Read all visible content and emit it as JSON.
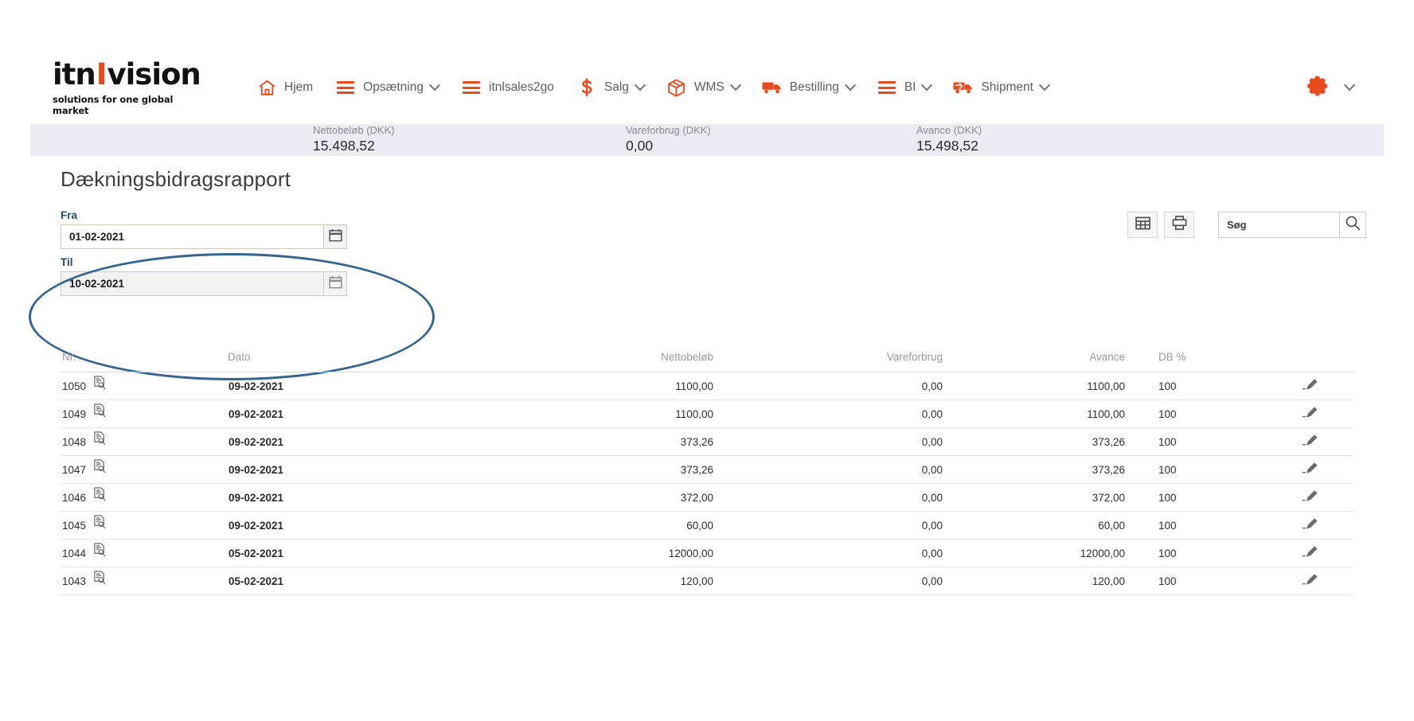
{
  "brand": {
    "logo_part1": "itn",
    "logo_bar": "I",
    "logo_part2": "vision",
    "tagline": "solutions for one global market",
    "accent_color": "#e8491d",
    "annotation_color": "#35658f"
  },
  "nav": {
    "items": [
      {
        "label": "Hjem",
        "icon": "home-icon",
        "caret": false
      },
      {
        "label": "Opsætning",
        "icon": "hamburger-icon",
        "caret": true
      },
      {
        "label": "itnlsales2go",
        "icon": "hamburger-icon",
        "caret": false
      },
      {
        "label": "Salg",
        "icon": "dollar-icon",
        "caret": true
      },
      {
        "label": "WMS",
        "icon": "box-icon",
        "caret": true
      },
      {
        "label": "Bestilling",
        "icon": "truck-icon",
        "caret": true
      },
      {
        "label": "BI",
        "icon": "hamburger-icon",
        "caret": true
      },
      {
        "label": "Shipment",
        "icon": "truck-arrow-icon",
        "caret": true
      }
    ],
    "settings_icon": "gear-icon"
  },
  "kpis": [
    {
      "label": "Nettobeløb (DKK)",
      "value": "15.498,52"
    },
    {
      "label": "Vareforbrug (DKK)",
      "value": "0,00"
    },
    {
      "label": "Avance (DKK)",
      "value": "15.498,52"
    }
  ],
  "page": {
    "title": "Dækningsbidragsrapport"
  },
  "filters": {
    "from_label": "Fra",
    "from_value": "01-02-2021",
    "to_label": "Til",
    "to_value": "10-02-2021",
    "calendar_icon": "calendar-icon"
  },
  "toolbar": {
    "grid_icon": "grid-icon",
    "print_icon": "printer-icon",
    "search_placeholder": "Søg",
    "search_value": "",
    "search_icon": "search-icon"
  },
  "table": {
    "columns": [
      "Nr.",
      "Dato",
      "Nettobeløb",
      "Vareforbrug",
      "Avance",
      "DB %"
    ],
    "row_icon": "document-search-icon",
    "action_icon": "pencil-icon",
    "rows": [
      {
        "nr": "1050",
        "dato": "09-02-2021",
        "nettobelob": "1100,00",
        "vareforbrug": "0,00",
        "avance": "1100,00",
        "db": "100"
      },
      {
        "nr": "1049",
        "dato": "09-02-2021",
        "nettobelob": "1100,00",
        "vareforbrug": "0,00",
        "avance": "1100,00",
        "db": "100"
      },
      {
        "nr": "1048",
        "dato": "09-02-2021",
        "nettobelob": "373,26",
        "vareforbrug": "0,00",
        "avance": "373,26",
        "db": "100"
      },
      {
        "nr": "1047",
        "dato": "09-02-2021",
        "nettobelob": "373,26",
        "vareforbrug": "0,00",
        "avance": "373,26",
        "db": "100"
      },
      {
        "nr": "1046",
        "dato": "09-02-2021",
        "nettobelob": "372,00",
        "vareforbrug": "0,00",
        "avance": "372,00",
        "db": "100"
      },
      {
        "nr": "1045",
        "dato": "09-02-2021",
        "nettobelob": "60,00",
        "vareforbrug": "0,00",
        "avance": "60,00",
        "db": "100"
      },
      {
        "nr": "1044",
        "dato": "05-02-2021",
        "nettobelob": "12000,00",
        "vareforbrug": "0,00",
        "avance": "12000,00",
        "db": "100"
      },
      {
        "nr": "1043",
        "dato": "05-02-2021",
        "nettobelob": "120,00",
        "vareforbrug": "0,00",
        "avance": "120,00",
        "db": "100"
      }
    ]
  }
}
